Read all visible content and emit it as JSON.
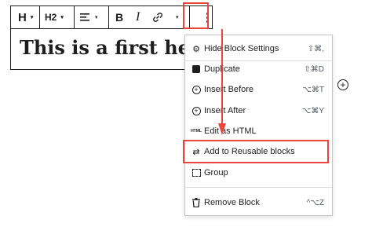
{
  "toolbar": {
    "heading_type": "H",
    "heading_level": "H2",
    "bold": "B",
    "italic": "I",
    "caret": "▾"
  },
  "block": {
    "heading_text": "This is a first heading"
  },
  "menu": {
    "items": [
      {
        "label": "Hide Block Settings",
        "shortcut": "⇧⌘,",
        "icon": "gear-icon"
      },
      {
        "label": "Duplicate",
        "shortcut": "⇧⌘D",
        "icon": "duplicate-icon"
      },
      {
        "label": "Insert Before",
        "shortcut": "⌥⌘T",
        "icon": "insert-before-icon"
      },
      {
        "label": "Insert After",
        "shortcut": "⌥⌘Y",
        "icon": "insert-after-icon"
      },
      {
        "label": "Edit as HTML",
        "shortcut": "",
        "icon": "html-icon"
      },
      {
        "label": "Add to Reusable blocks",
        "shortcut": "",
        "icon": "reusable-icon"
      },
      {
        "label": "Group",
        "shortcut": "",
        "icon": "group-icon"
      },
      {
        "label": "Remove Block",
        "shortcut": "^⌥Z",
        "icon": "trash-icon"
      }
    ],
    "html_icon_text": "HTML"
  },
  "colors": {
    "highlight": "#e8453c",
    "text": "#1e1e1e"
  }
}
